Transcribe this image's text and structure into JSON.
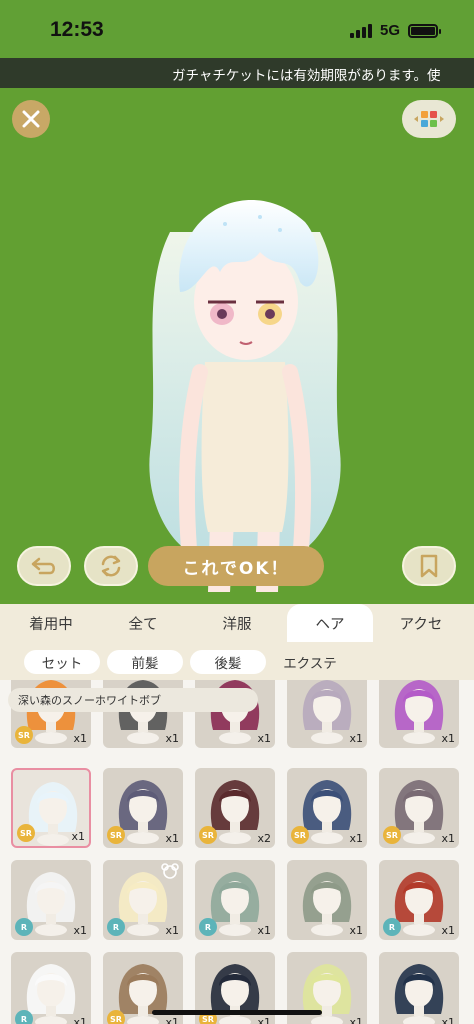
{
  "status_bar": {
    "time": "12:53",
    "network": "5G"
  },
  "ticker": {
    "text": "ガチャチケットには有効期限があります。使"
  },
  "stage": {
    "ok_label": "これでOK！"
  },
  "category_tabs": [
    {
      "label": "着用中",
      "active": false
    },
    {
      "label": "全て",
      "active": false
    },
    {
      "label": "洋服",
      "active": false
    },
    {
      "label": "ヘア",
      "active": true
    },
    {
      "label": "アクセ",
      "active": false
    }
  ],
  "sub_tabs": [
    {
      "label": "セット",
      "active": true
    },
    {
      "label": "前髪",
      "active": true
    },
    {
      "label": "後髪",
      "active": true
    },
    {
      "label": "エクステ",
      "active": false
    }
  ],
  "selected_item": {
    "name": "深い森のスノーホワイトボブ"
  },
  "items": [
    {
      "rarity": "SR",
      "count": "x1",
      "hair_color": "#f08a2c"
    },
    {
      "rarity": "",
      "count": "x1",
      "hair_color": "#555555"
    },
    {
      "rarity": "",
      "count": "x1",
      "hair_color": "#8a2a52"
    },
    {
      "rarity": "",
      "count": "x1",
      "hair_color": "#b7a9bd"
    },
    {
      "rarity": "",
      "count": "x1",
      "hair_color": "#b45bc8"
    },
    {
      "rarity": "SR",
      "count": "x1",
      "hair_color": "#e8f4fb",
      "selected": true
    },
    {
      "rarity": "SR",
      "count": "x1",
      "hair_color": "#5e5c78"
    },
    {
      "rarity": "SR",
      "count": "x2",
      "hair_color": "#5a2a2c"
    },
    {
      "rarity": "SR",
      "count": "x1",
      "hair_color": "#3b4f78"
    },
    {
      "rarity": "SR",
      "count": "x1",
      "hair_color": "#7a6b74"
    },
    {
      "rarity": "R",
      "count": "x1",
      "hair_color": "#f5f5f5"
    },
    {
      "rarity": "R",
      "count": "x1",
      "hair_color": "#f7ecc4"
    },
    {
      "rarity": "R",
      "count": "x1",
      "hair_color": "#8fa89a"
    },
    {
      "rarity": "",
      "count": "x1",
      "hair_color": "#8e9a88"
    },
    {
      "rarity": "R",
      "count": "x1",
      "hair_color": "#b33a2a"
    },
    {
      "rarity": "R",
      "count": "x1",
      "hair_color": "#fafafa"
    },
    {
      "rarity": "SR",
      "count": "x1",
      "hair_color": "#9a7a5a"
    },
    {
      "rarity": "SR",
      "count": "x1",
      "hair_color": "#232a3a"
    },
    {
      "rarity": "",
      "count": "x1",
      "hair_color": "#dfe69a"
    },
    {
      "rarity": "",
      "count": "x1",
      "hair_color": "#22324a"
    }
  ],
  "colors": {
    "stage_green": "#62a032",
    "gold": "#c8a55f",
    "tab_bg": "#f1ebdb",
    "selected_border": "#e98ea2",
    "sr_badge": "#e9b43b",
    "r_badge": "#5db4b9"
  },
  "icons": {
    "close": "close-icon",
    "layout": "grid-layout-icon",
    "undo": "undo-icon",
    "rotate": "rotate-icon",
    "bookmark": "bookmark-icon",
    "new": "bear-badge-icon"
  }
}
